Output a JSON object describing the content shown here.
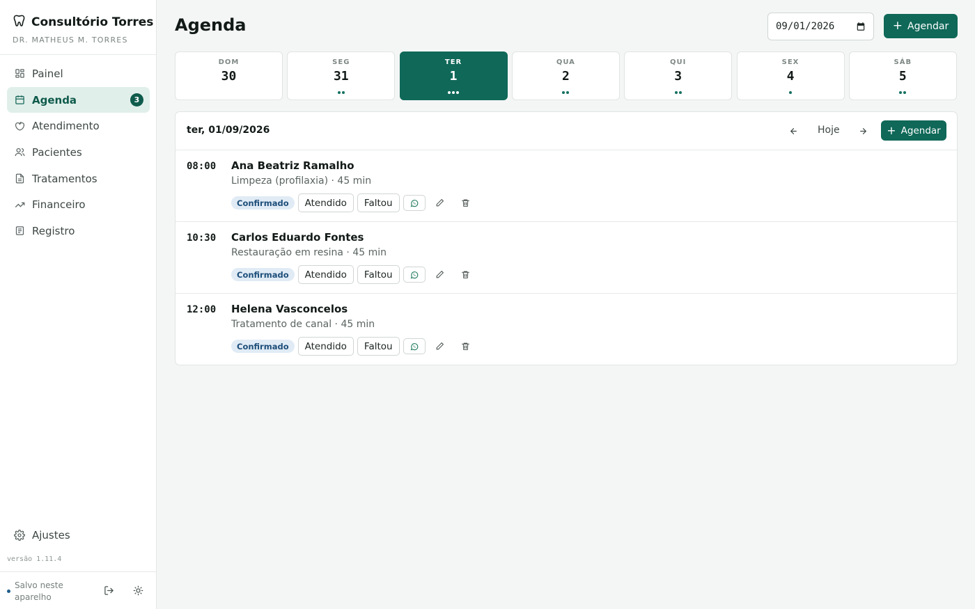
{
  "brand": {
    "title": "Consultório Torres",
    "subtitle": "DR. MATHEUS M. TORRES"
  },
  "nav": [
    {
      "label": "Painel",
      "icon": "grid-icon"
    },
    {
      "label": "Agenda",
      "icon": "calendar-icon",
      "badge": "3",
      "active": true
    },
    {
      "label": "Atendimento",
      "icon": "tooth-icon"
    },
    {
      "label": "Pacientes",
      "icon": "users-icon"
    },
    {
      "label": "Tratamentos",
      "icon": "file-icon"
    },
    {
      "label": "Financeiro",
      "icon": "trending-up-icon"
    },
    {
      "label": "Registro",
      "icon": "log-icon"
    }
  ],
  "settings": {
    "label": "Ajustes"
  },
  "version": "versão 1.11.4",
  "footer": {
    "saved": "Salvo neste aparelho"
  },
  "header": {
    "title": "Agenda",
    "date_value": "09/01/2026",
    "add_label": "Agendar"
  },
  "week": [
    {
      "dow": "DOM",
      "num": "30",
      "count": 0
    },
    {
      "dow": "SEG",
      "num": "31",
      "count": 2
    },
    {
      "dow": "TER",
      "num": "1",
      "count": 3,
      "active": true
    },
    {
      "dow": "QUA",
      "num": "2",
      "count": 2
    },
    {
      "dow": "QUI",
      "num": "3",
      "count": 2
    },
    {
      "dow": "SEX",
      "num": "4",
      "count": 1
    },
    {
      "dow": "SÁB",
      "num": "5",
      "count": 2
    }
  ],
  "panel": {
    "date_label": "ter, 01/09/2026",
    "today_label": "Hoje",
    "add_label": "Agendar",
    "status_label": "Confirmado",
    "attended_label": "Atendido",
    "missed_label": "Faltou"
  },
  "appointments": [
    {
      "time": "08:00",
      "name": "Ana Beatriz Ramalho",
      "detail": "Limpeza (profilaxia) · 45 min",
      "status": "Confirmado"
    },
    {
      "time": "10:30",
      "name": "Carlos Eduardo Fontes",
      "detail": "Restauração em resina · 45 min",
      "status": "Confirmado"
    },
    {
      "time": "12:00",
      "name": "Helena Vasconcelos",
      "detail": "Tratamento de canal · 45 min",
      "status": "Confirmado"
    }
  ],
  "colors": {
    "accent": "#0f6858",
    "active_nav_bg": "#e1efea",
    "status_badge_bg": "#e0ebf5",
    "status_badge_text": "#1d4e7a"
  }
}
